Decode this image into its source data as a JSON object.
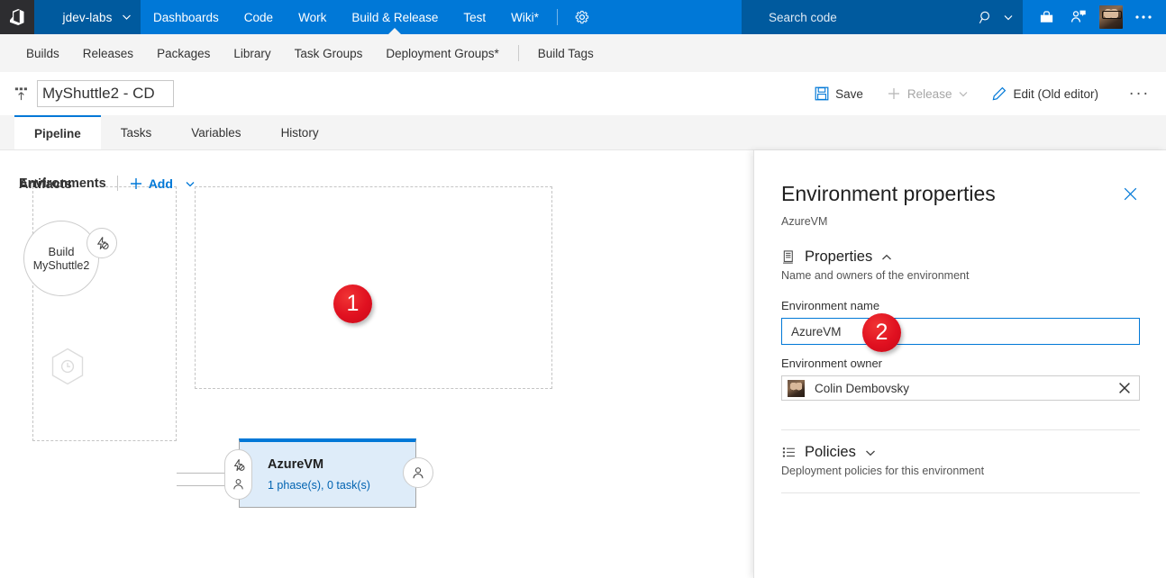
{
  "topnav": {
    "logo_icon": "vsts-logo-icon",
    "project": "jdev-labs",
    "project_chevron_icon": "chevron-down-icon",
    "links": [
      {
        "label": "Dashboards",
        "active": false
      },
      {
        "label": "Code",
        "active": false
      },
      {
        "label": "Work",
        "active": false
      },
      {
        "label": "Build & Release",
        "active": true
      },
      {
        "label": "Test",
        "active": false
      },
      {
        "label": "Wiki*",
        "active": false
      }
    ],
    "gear_icon": "gear-icon",
    "search_placeholder": "Search code",
    "search_value": "",
    "search_icon": "search-icon",
    "search_chevron_icon": "chevron-down-icon",
    "marketplace_icon": "marketplace-bag-icon",
    "feedback_icon": "user-feedback-icon",
    "avatar_icon": "user-avatar",
    "more_icon": "ellipsis-icon"
  },
  "hubnav": {
    "items": [
      "Builds",
      "Releases",
      "Packages",
      "Library",
      "Task Groups",
      "Deployment Groups*"
    ],
    "trailing": [
      "Build Tags"
    ]
  },
  "toolbar": {
    "release_icon": "release-pipeline-icon",
    "title_value": "MyShuttle2 - CD",
    "save_label": "Save",
    "save_icon": "save-disk-icon",
    "release_label": "Release",
    "release_plus_icon": "plus-icon",
    "release_chevron_icon": "chevron-down-icon",
    "edit_label": "Edit (Old editor)",
    "edit_icon": "pencil-icon",
    "more_label": "···",
    "cursor_icon": "mouse-cursor-icon"
  },
  "tabs": [
    {
      "label": "Pipeline",
      "active": true
    },
    {
      "label": "Tasks",
      "active": false
    },
    {
      "label": "Variables",
      "active": false
    },
    {
      "label": "History",
      "active": false
    }
  ],
  "canvas": {
    "artifacts": {
      "title": "Artifacts",
      "item": {
        "type_label": "Build",
        "name": "MyShuttle2",
        "trigger_icon": "continuous-deployment-trigger-icon"
      },
      "schedule_icon": "scheduled-trigger-hexagon-icon"
    },
    "environments": {
      "title": "Environments",
      "add_label": "Add",
      "add_icon": "plus-icon",
      "add_chevron_icon": "chevron-down-icon",
      "card": {
        "name": "AzureVM",
        "summary": "1 phase(s), 0 task(s)",
        "pre_trigger_icon": "pre-deployment-trigger-icon",
        "pre_approval_icon": "pre-deployment-approval-icon",
        "post_approval_icon": "post-deployment-approval-icon"
      }
    }
  },
  "annotations": [
    {
      "number": "1"
    },
    {
      "number": "2"
    }
  ],
  "panel": {
    "title": "Environment properties",
    "subtitle": "AzureVM",
    "close_icon": "close-icon",
    "properties": {
      "section_icon": "server-rack-icon",
      "section_title": "Properties",
      "collapse_icon": "chevron-up-icon",
      "description": "Name and owners of the environment",
      "name_label": "Environment name",
      "name_value": "AzureVM",
      "owner_label": "Environment owner",
      "owner_value": "Colin Dembovsky",
      "owner_avatar_icon": "user-avatar",
      "owner_clear_icon": "clear-x-icon"
    },
    "policies": {
      "section_icon": "policy-list-icon",
      "section_title": "Policies",
      "expand_icon": "chevron-down-icon",
      "description": "Deployment policies for this environment"
    }
  },
  "colors": {
    "nav_blue": "#0078d7",
    "nav_blue_dark": "#005a9e",
    "logo_dark": "#2d2d30",
    "accent_link": "#0078d7",
    "annotation_red": "#e01020",
    "card_fill": "#deecf9",
    "hub_bg": "#f4f4f4"
  }
}
